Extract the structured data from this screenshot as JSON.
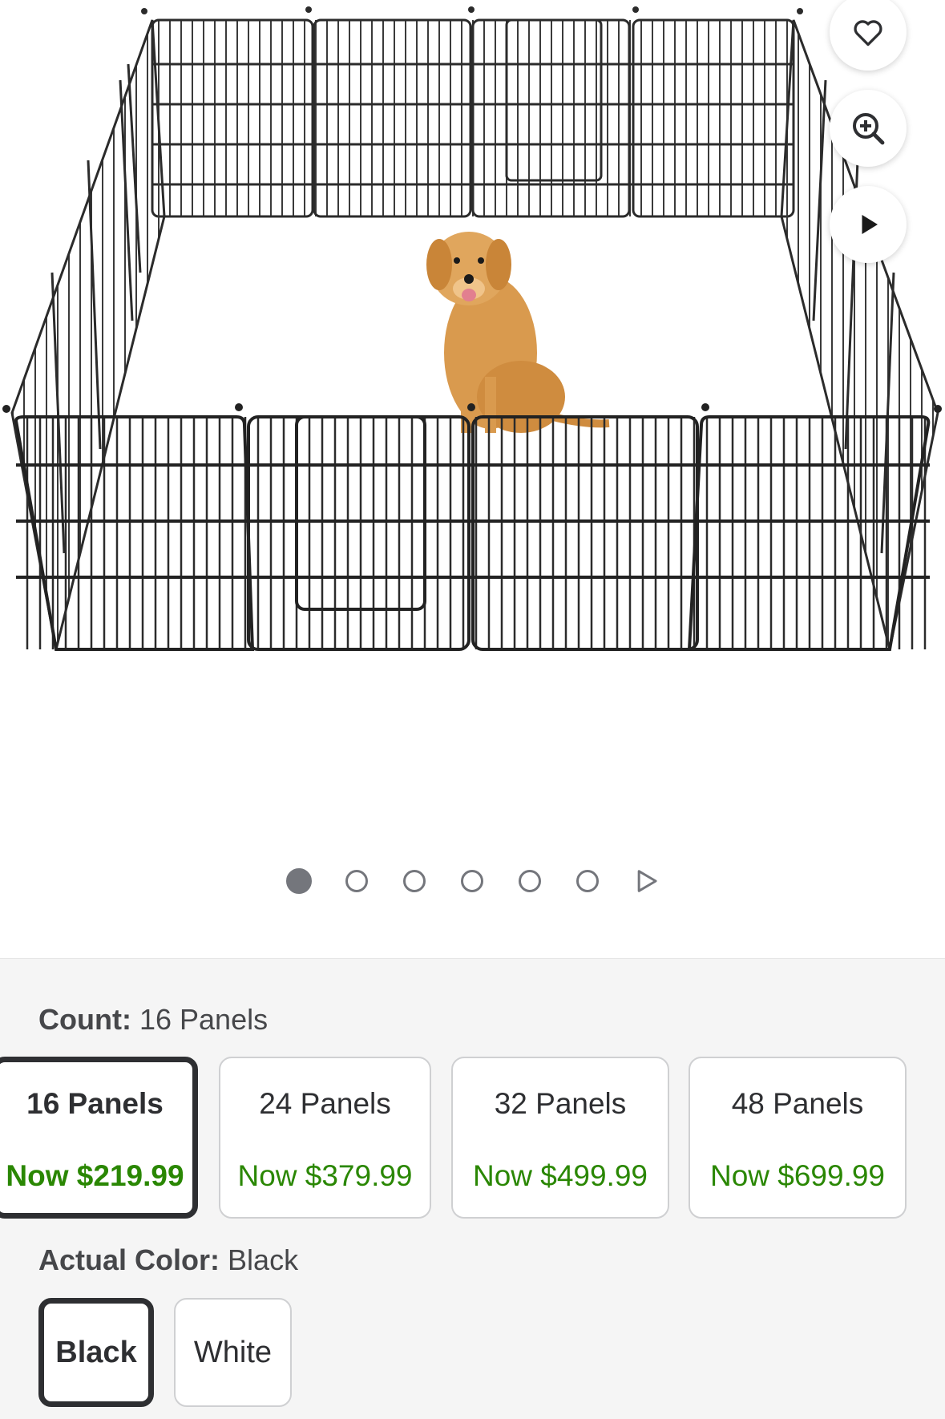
{
  "image_alt": "",
  "actions": {
    "favorite": "heart-icon",
    "zoom": "zoom-in-icon",
    "video": "play-icon"
  },
  "carousel": {
    "count": 6,
    "active_index": 0
  },
  "count_option": {
    "label": "Count:",
    "selected": "16 Panels",
    "choices": [
      {
        "name": "16 Panels",
        "price": "Now $219.99",
        "selected": true
      },
      {
        "name": "24 Panels",
        "price": "Now $379.99",
        "selected": false
      },
      {
        "name": "32 Panels",
        "price": "Now $499.99",
        "selected": false
      },
      {
        "name": "48 Panels",
        "price": "Now $699.99",
        "selected": false
      }
    ]
  },
  "color_option": {
    "label": "Actual Color:",
    "selected": "Black",
    "choices": [
      {
        "name": "Black",
        "selected": true
      },
      {
        "name": "White",
        "selected": false
      }
    ]
  },
  "colors": {
    "price_green": "#2a8703",
    "selected_border": "#2e2f32",
    "options_bg": "#f5f5f5"
  }
}
